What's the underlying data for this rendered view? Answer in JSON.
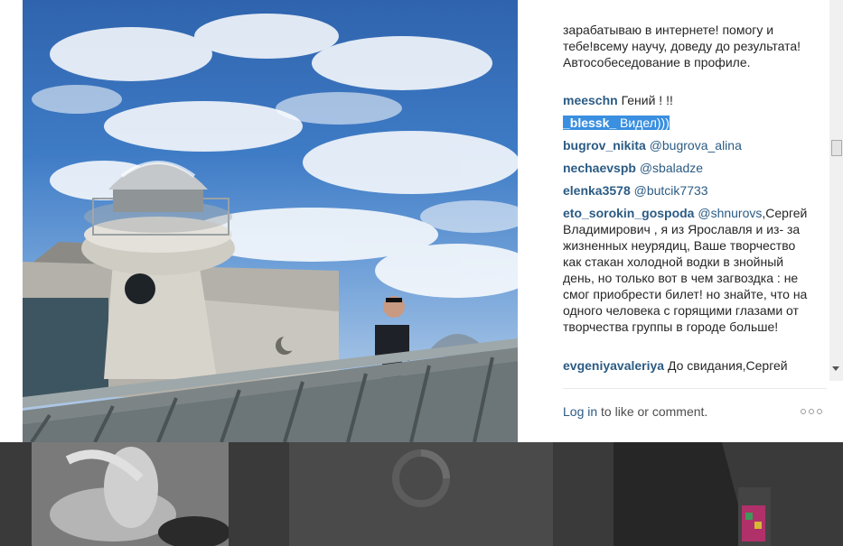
{
  "header": {
    "likes_text": ""
  },
  "post": {
    "caption": "зарабатываю в интернете! помогу и тебе!всему научу, доведу до результата!Автособеседование в профиле."
  },
  "comments": [
    {
      "user": "meeschn",
      "text": " Гений ! !!"
    },
    {
      "user": "_blessk_",
      "text": " Видел)))",
      "selected": true
    },
    {
      "user": "bugrov_nikita",
      "mention": "@bugrova_alina",
      "text": ""
    },
    {
      "user": "nechaevspb",
      "mention": "@sbaladze",
      "text": ""
    },
    {
      "user": "elenka3578",
      "mention": "@butcik7733",
      "text": ""
    },
    {
      "user": "eto_sorokin_gospoda",
      "mention": "@shnurovs",
      "text": ",Сергей Владимирович , я из Ярославля и из- за жизненных неурядиц, Ваше творчество как стакан холодной водки в знойный день, но только вот в чем загвоздка : не смог приобрести билет! но знайте, что на одного человека с горящими глазами от творчества группы в городе больше!"
    },
    {
      "user": "evgeniyavaleriya",
      "text": " До свидания,Сергей"
    }
  ],
  "footer": {
    "login_link": "Log in",
    "rest": " to like or comment."
  },
  "icons": {
    "more": "more-options-icon",
    "scroll_down": "scroll-down-arrow-icon",
    "loading": "loading-spinner-icon"
  },
  "colors": {
    "link": "#2b5b84",
    "selection": "#3a8fe0",
    "backdrop": "#3a3a3a"
  }
}
